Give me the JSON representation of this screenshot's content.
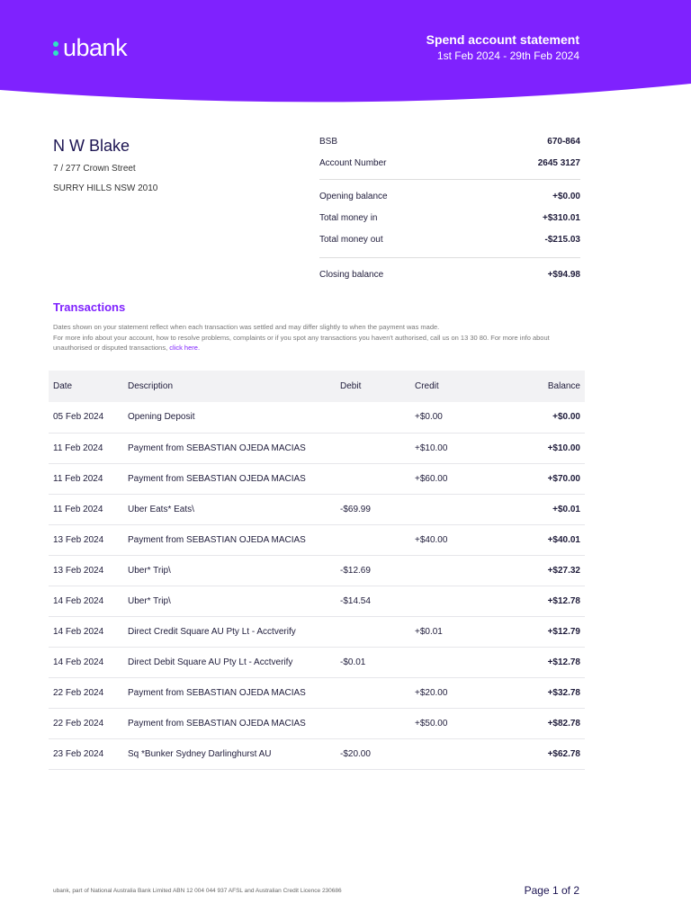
{
  "header": {
    "brand": "ubank",
    "title": "Spend account statement",
    "period": "1st Feb 2024 - 29th Feb 2024",
    "accent": "#7f22fe"
  },
  "customer": {
    "name": "N W Blake",
    "address1": "7 / 277 Crown Street",
    "address2": "SURRY HILLS NSW 2010"
  },
  "account": {
    "bsb_label": "BSB",
    "bsb": "670-864",
    "number_label": "Account Number",
    "number": "2645 3127"
  },
  "summary": {
    "opening_label": "Opening balance",
    "opening": "+$0.00",
    "in_label": "Total money in",
    "in": "+$310.01",
    "out_label": "Total money out",
    "out": "-$215.03",
    "closing_label": "Closing balance",
    "closing": "+$94.98"
  },
  "transactions": {
    "title": "Transactions",
    "note1": "Dates shown on your statement reflect when each transaction was settled and may differ slightly to when the payment was made.",
    "note2": "For more info about your account, how to resolve problems, complaints or if you spot any transactions you haven't authorised, call us on 13 30 80. For more info about unauthorised or disputed transactions,",
    "link": "click here.",
    "headers": [
      "Date",
      "Description",
      "Debit",
      "Credit",
      "Balance"
    ],
    "rows": [
      [
        "05 Feb 2024",
        "Opening Deposit",
        "",
        "+$0.00",
        "+$0.00"
      ],
      [
        "11 Feb 2024",
        "Payment from SEBASTIAN OJEDA MACIAS",
        "",
        "+$10.00",
        "+$10.00"
      ],
      [
        "11 Feb 2024",
        "Payment from SEBASTIAN OJEDA MACIAS",
        "",
        "+$60.00",
        "+$70.00"
      ],
      [
        "11 Feb 2024",
        "Uber Eats* Eats\\",
        "-$69.99",
        "",
        "+$0.01"
      ],
      [
        "13 Feb 2024",
        "Payment from SEBASTIAN OJEDA MACIAS",
        "",
        "+$40.00",
        "+$40.01"
      ],
      [
        "13 Feb 2024",
        "Uber* Trip\\",
        "-$12.69",
        "",
        "+$27.32"
      ],
      [
        "14 Feb 2024",
        "Uber* Trip\\",
        "-$14.54",
        "",
        "+$12.78"
      ],
      [
        "14 Feb 2024",
        "Direct Credit Square AU Pty Lt - Acctverify",
        "",
        "+$0.01",
        "+$12.79"
      ],
      [
        "14 Feb 2024",
        "Direct Debit Square AU Pty Lt - Acctverify",
        "-$0.01",
        "",
        "+$12.78"
      ],
      [
        "22 Feb 2024",
        "Payment from SEBASTIAN OJEDA MACIAS",
        "",
        "+$20.00",
        "+$32.78"
      ],
      [
        "22 Feb 2024",
        "Payment from SEBASTIAN OJEDA MACIAS",
        "",
        "+$50.00",
        "+$82.78"
      ],
      [
        "23 Feb 2024",
        "Sq *Bunker Sydney Darlinghurst AU",
        "-$20.00",
        "",
        "+$62.78"
      ]
    ]
  },
  "footer": {
    "legal": "ubank, part of National Australia Bank Limited ABN 12 004 044 937 AFSL and Australian Credit Licence 230686",
    "page": "Page 1 of 2"
  }
}
